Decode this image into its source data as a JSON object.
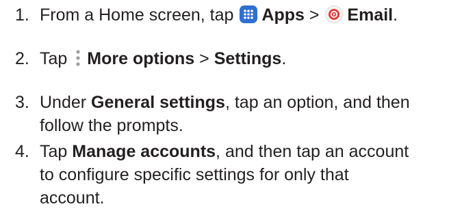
{
  "steps": [
    {
      "number": "1.",
      "lines": [
        {
          "pre": "From a Home screen, tap ",
          "bold1": "Apps",
          "mid": " > ",
          "bold2": "Email",
          "post": "."
        }
      ],
      "icons": [
        "apps-icon",
        "email-icon"
      ]
    },
    {
      "number": "2.",
      "lines": [
        {
          "pre": "Tap ",
          "bold1": "More options",
          "mid": " > ",
          "bold2": "Settings",
          "post": "."
        }
      ],
      "icons": [
        "more-options-icon"
      ]
    },
    {
      "number": "3.",
      "lines": [
        {
          "pre": "Under ",
          "bold": "General settings",
          "post": ", tap an option, and then"
        },
        {
          "text": "follow the prompts."
        }
      ]
    },
    {
      "number": "4.",
      "lines": [
        {
          "pre": "Tap ",
          "bold": "Manage accounts",
          "post": ", and then tap an account"
        },
        {
          "text": "to configure specific settings for only that"
        },
        {
          "text": "account."
        }
      ]
    }
  ],
  "colors": {
    "text": "#231f20",
    "apps_icon_bg": "#2f6fd0",
    "email_icon_accent": "#e53935",
    "more_icon_dots": "#9e9e9e"
  }
}
